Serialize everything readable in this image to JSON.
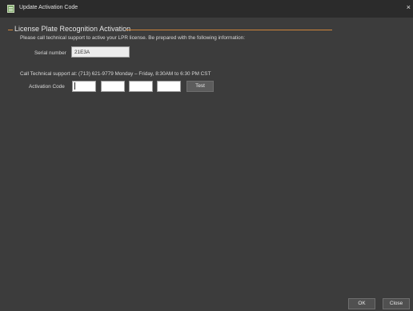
{
  "window": {
    "title": "Update Activation Code",
    "close_glyph": "×"
  },
  "section": {
    "title": "License Plate Recognition Activation",
    "intro": "Please call technical support to active your LPR license.  Be prepared with the following information:"
  },
  "serial": {
    "label": "Serial number",
    "value": "21E3A"
  },
  "support": {
    "text": "Call Technical support at: (713) 621-9779 Monday – Friday, 8:30AM to 6:30 PM CST"
  },
  "activation": {
    "label": "Activation Code",
    "fields": [
      "",
      "",
      "",
      ""
    ],
    "test_label": "Test"
  },
  "footer": {
    "ok_label": "OK",
    "close_label": "Close"
  },
  "colors": {
    "accent": "#d0843a",
    "background": "#3c3c3c"
  }
}
